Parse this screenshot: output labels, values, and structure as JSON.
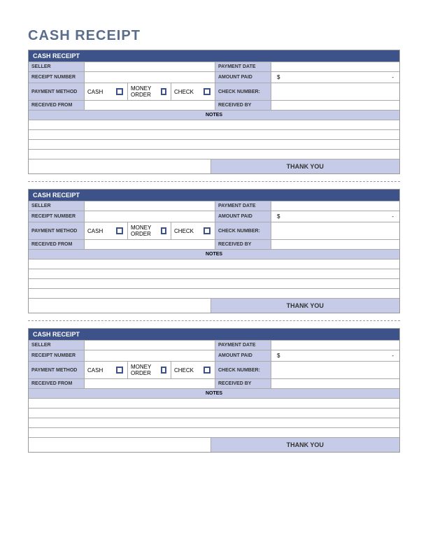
{
  "page_title": "CASH RECEIPT",
  "receipt": {
    "header": "CASH RECEIPT",
    "seller_label": "SELLER",
    "payment_date_label": "PAYMENT DATE",
    "receipt_number_label": "RECEIPT NUMBER",
    "amount_paid_label": "AMOUNT PAID",
    "amount_paid_currency": "$",
    "amount_paid_dash": "-",
    "payment_method_label": "PAYMENT METHOD",
    "cash_label": "CASH",
    "money_order_label": "MONEY ORDER",
    "check_label": "CHECK",
    "check_number_label": "CHECK NUMBER:",
    "received_from_label": "RECEIVED FROM",
    "received_by_label": "RECEIVED BY",
    "notes_label": "NOTES",
    "thank_you": "THANK YOU"
  }
}
